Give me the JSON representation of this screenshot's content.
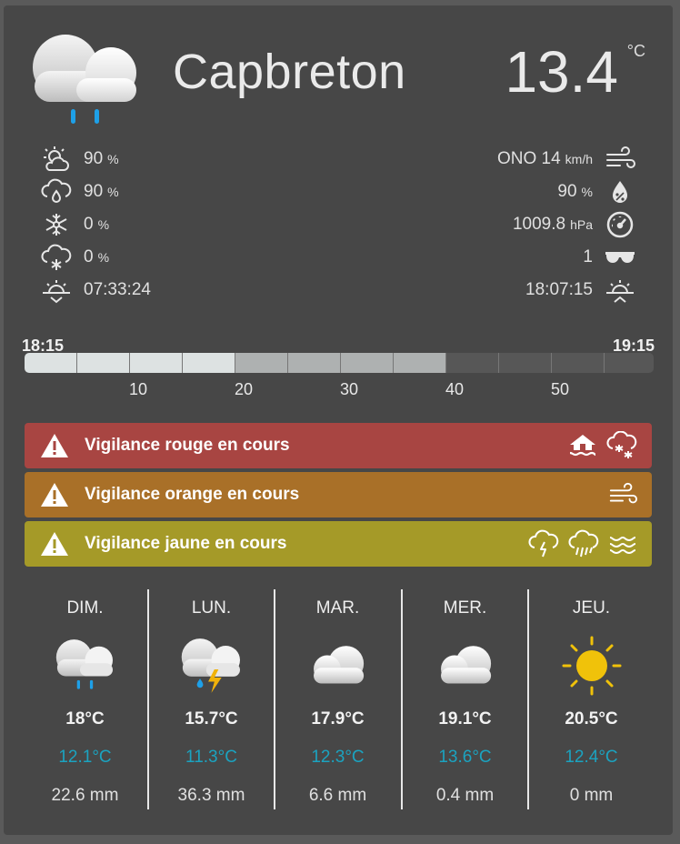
{
  "current": {
    "city": "Capbreton",
    "temperature": "13.4",
    "temp_unit": "°C",
    "icon": "rain-cloud-icon"
  },
  "details_left": [
    {
      "icon": "partly-cloudy-icon",
      "value": "90",
      "unit": "%"
    },
    {
      "icon": "rain-drop-cloud-icon",
      "value": "90",
      "unit": "%"
    },
    {
      "icon": "snowflake-icon",
      "value": "0",
      "unit": "%"
    },
    {
      "icon": "snow-cloud-icon",
      "value": "0",
      "unit": "%"
    },
    {
      "icon": "sunrise-icon",
      "value": "07:33:24",
      "unit": ""
    }
  ],
  "details_right": [
    {
      "icon": "wind-icon",
      "value": "ONO 14",
      "unit": "km/h"
    },
    {
      "icon": "humidity-icon",
      "value": "90",
      "unit": "%"
    },
    {
      "icon": "pressure-gauge-icon",
      "value": "1009.8",
      "unit": "hPa"
    },
    {
      "icon": "sunglasses-icon",
      "value": "1",
      "unit": ""
    },
    {
      "icon": "sunset-icon",
      "value": "18:07:15",
      "unit": ""
    }
  ],
  "rain_timeline": {
    "start": "18:15",
    "end": "19:15",
    "ticks": [
      "10",
      "20",
      "30",
      "40",
      "50"
    ],
    "segment_levels": [
      1,
      1,
      1,
      1,
      2,
      2,
      2,
      2,
      3,
      3,
      3,
      3
    ]
  },
  "alerts": [
    {
      "text": "Vigilance rouge en cours",
      "color": "#a84542",
      "icons": [
        "flood-icon",
        "snow-ice-icon"
      ]
    },
    {
      "text": "Vigilance orange en cours",
      "color": "#a97028",
      "icons": [
        "wind-icon"
      ]
    },
    {
      "text": "Vigilance jaune en cours",
      "color": "#a59a28",
      "icons": [
        "thunderstorm-icon",
        "heavy-rain-icon",
        "waves-icon"
      ]
    }
  ],
  "forecast": [
    {
      "day": "DIM.",
      "icon": "rain-cloud-icon",
      "max": "18°C",
      "min": "12.1°C",
      "rain": "22.6 mm"
    },
    {
      "day": "LUN.",
      "icon": "storm-cloud-icon",
      "max": "15.7°C",
      "min": "11.3°C",
      "rain": "36.3 mm"
    },
    {
      "day": "MAR.",
      "icon": "cloud-icon",
      "max": "17.9°C",
      "min": "12.3°C",
      "rain": "6.6 mm"
    },
    {
      "day": "MER.",
      "icon": "cloud-icon",
      "max": "19.1°C",
      "min": "13.6°C",
      "rain": "0.4 mm"
    },
    {
      "day": "JEU.",
      "icon": "sun-icon",
      "max": "20.5°C",
      "min": "12.4°C",
      "rain": "0 mm"
    }
  ],
  "colors": {
    "background": "#474747",
    "min_temp": "#1ba3c0",
    "rain_drop": "#1ea0e8",
    "sun": "#f0c20a",
    "bar_level_1": "#dde2e2",
    "bar_level_2": "#aeb1b1",
    "bar_level_3": "#575757"
  }
}
